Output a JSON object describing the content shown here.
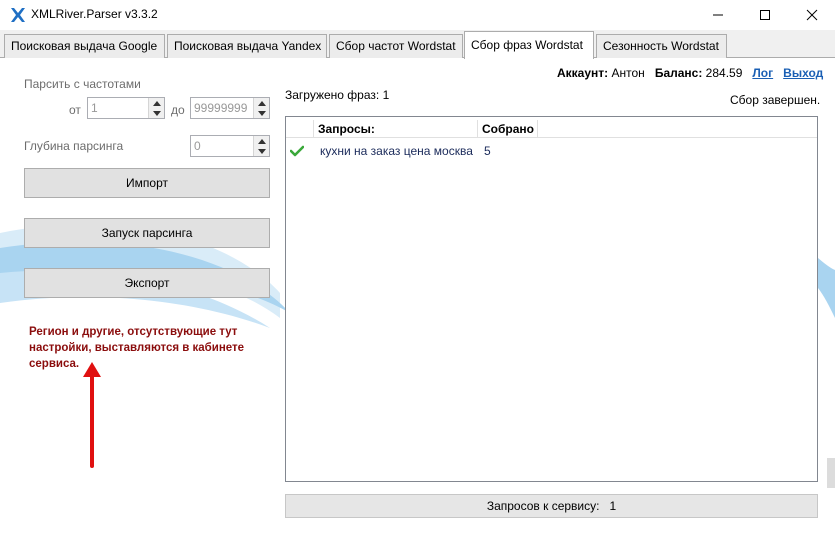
{
  "window": {
    "title": "XMLRiver.Parser v3.3.2",
    "minimize_glyph": "—",
    "maximize_glyph": "☐",
    "close_glyph": "✕"
  },
  "tabs": [
    {
      "label": "Поисковая выдача Google",
      "active": false
    },
    {
      "label": "Поисковая выдача Yandex",
      "active": false
    },
    {
      "label": "Сбор частот Wordstat",
      "active": false
    },
    {
      "label": "Сбор фраз Wordstat",
      "active": true
    },
    {
      "label": "Сезонность Wordstat",
      "active": false
    }
  ],
  "settings": {
    "freq_label": "Парсить с частотами",
    "from_label": "от",
    "from_value": "1",
    "to_label": "до",
    "to_value": "99999999",
    "depth_label": "Глубина парсинга",
    "depth_value": "0"
  },
  "buttons": {
    "import": "Импорт",
    "start": "Запуск парсинга",
    "export": "Экспорт"
  },
  "note": "Регион и другие, отсутствующие тут настройки, выставляются в кабинете сервиса.",
  "account": {
    "account_label": "Аккаунт:",
    "account_name": "Антон",
    "balance_label": "Баланс:",
    "balance_value": "284.59",
    "log_link": "Лог",
    "logout_link": "Выход"
  },
  "results": {
    "loaded_label": "Загружено фраз: 1",
    "status": "Сбор завершен.",
    "columns": [
      "Запросы:",
      "Собрано"
    ],
    "rows": [
      {
        "status_icon": "check-icon",
        "query": "кухни на заказ цена москва",
        "collected": "5"
      }
    ]
  },
  "footer": {
    "requests_label": "Запросов к сервису:",
    "requests_value": "1"
  },
  "colors": {
    "note_text": "#8b0d0d",
    "arrow": "#e01010",
    "link": "#1a5fb4",
    "check": "#3aa83a"
  }
}
